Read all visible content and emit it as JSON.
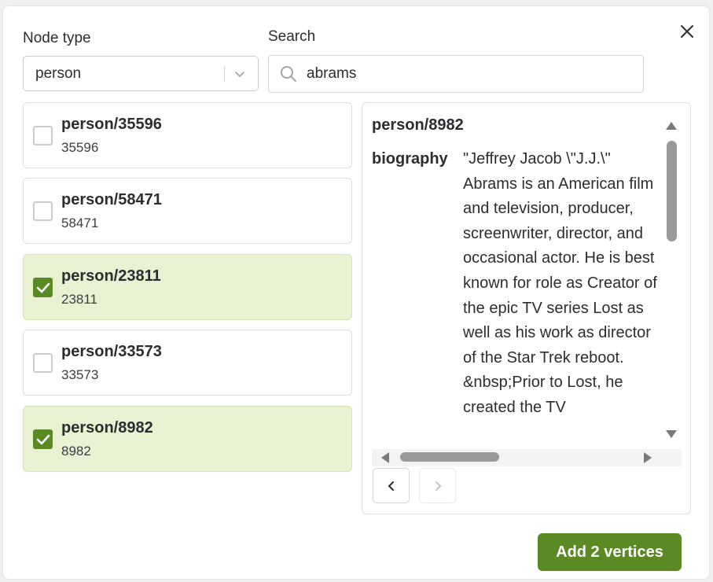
{
  "dialog": {
    "node_type_label": "Node type",
    "node_type_value": "person",
    "search_label": "Search",
    "search_value": "abrams"
  },
  "results": [
    {
      "title": "person/35596",
      "id": "35596",
      "checked": false
    },
    {
      "title": "person/58471",
      "id": "58471",
      "checked": false
    },
    {
      "title": "person/23811",
      "id": "23811",
      "checked": true
    },
    {
      "title": "person/33573",
      "id": "33573",
      "checked": false
    },
    {
      "title": "person/8982",
      "id": "8982",
      "checked": true
    }
  ],
  "detail": {
    "title": "person/8982",
    "property_key": "biography",
    "property_value": "\"Jeffrey Jacob \\\"J.J.\\\" Abrams is an American film and television, producer, screenwriter, director, and occasional actor. He is best known for role as Creator of the epic TV series Lost as well as his work as director of the Star Trek reboot. &nbsp;Prior to Lost, he created the TV"
  },
  "footer": {
    "add_button_label": "Add 2 vertices"
  },
  "colors": {
    "accent": "#5b8a24",
    "selected_row": "#e8f2d2"
  },
  "icons": {
    "close": "close-icon",
    "search": "search-icon",
    "dropdown": "chevron-down-icon",
    "check": "check-icon",
    "prev": "chevron-left-icon",
    "next": "chevron-right-icon"
  }
}
